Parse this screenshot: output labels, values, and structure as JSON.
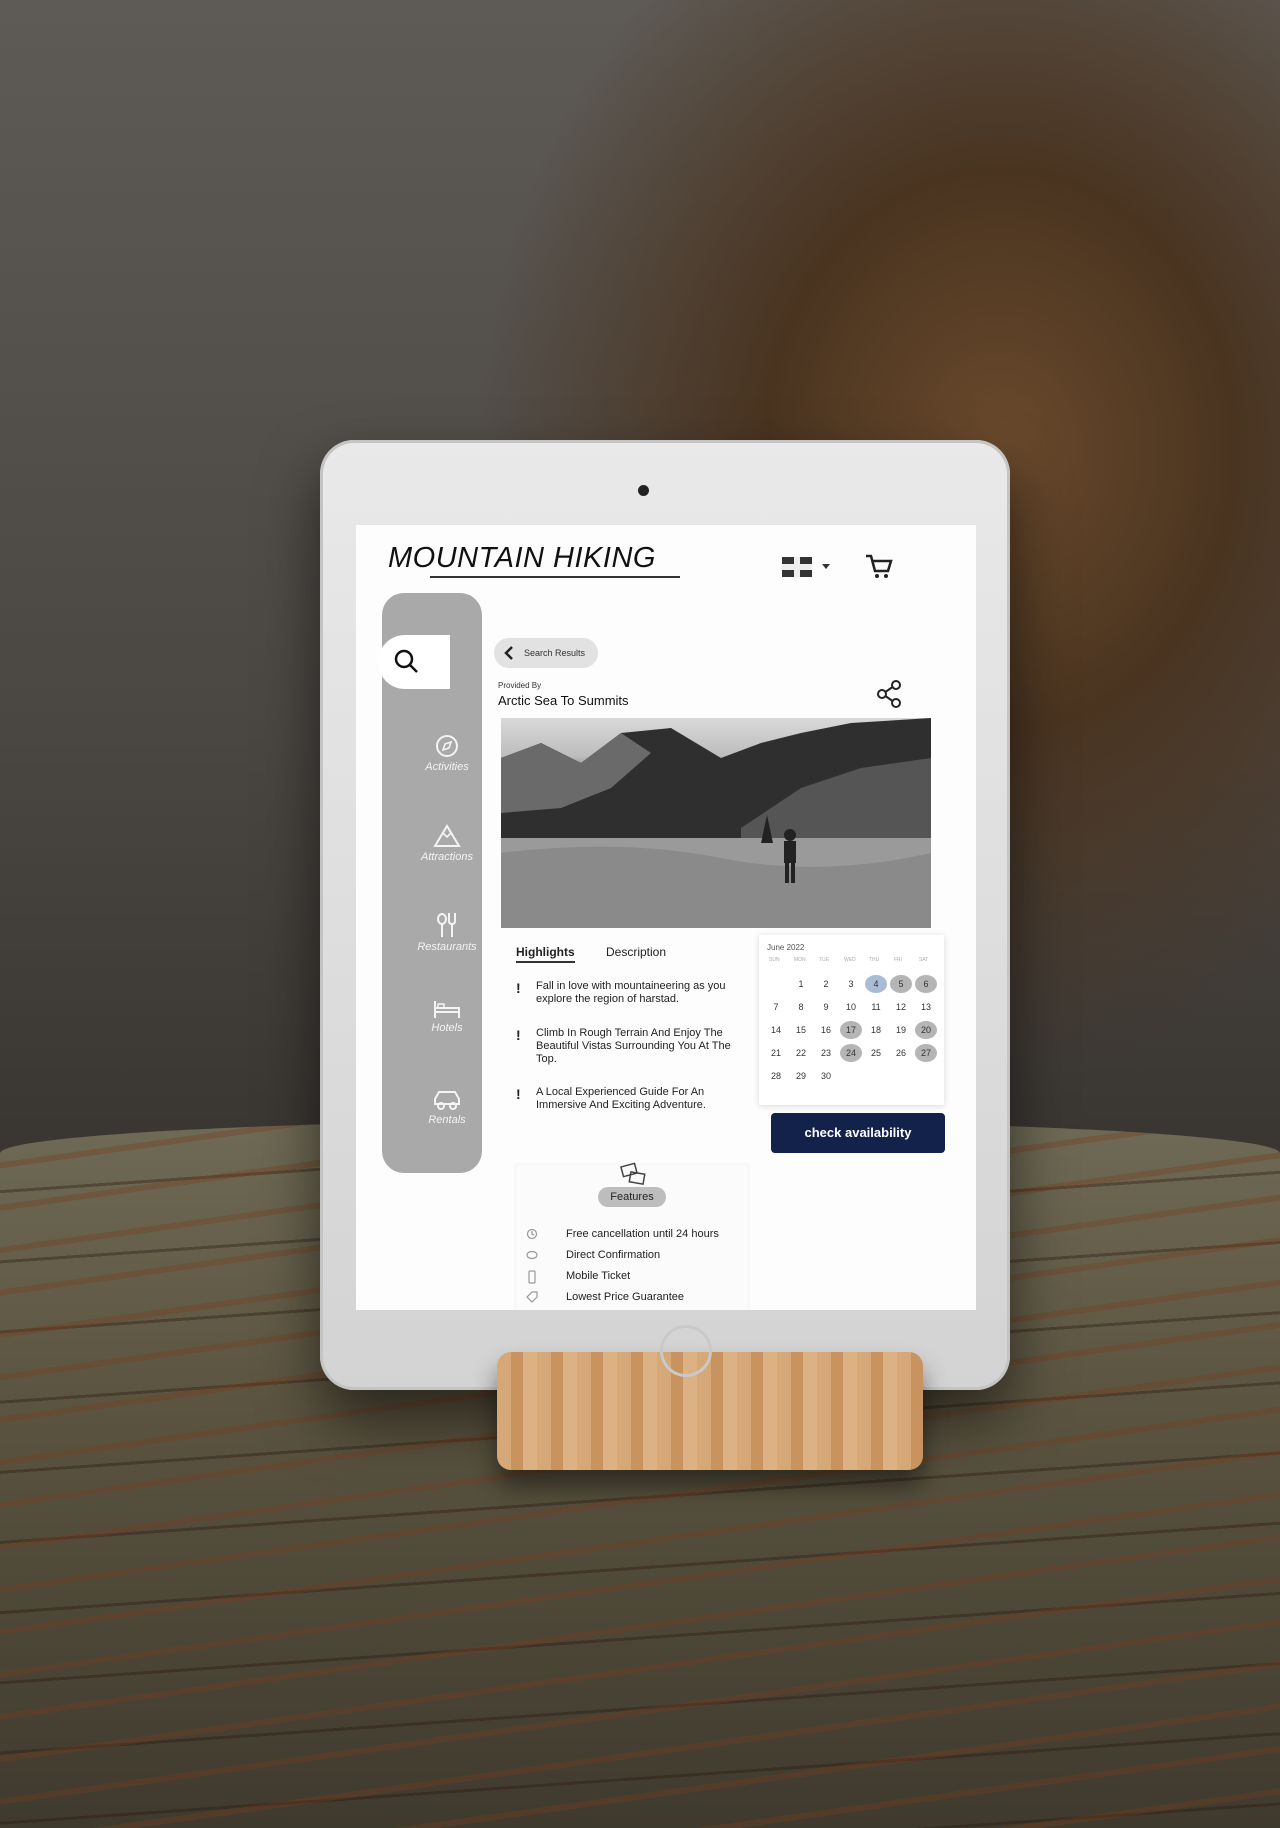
{
  "header": {
    "title": "MOUNTAIN HIKING",
    "language_icon": "uk-flag-icon",
    "cart_icon": "cart-icon"
  },
  "sidebar": {
    "search_icon": "search-icon",
    "items": [
      {
        "label": "Activities",
        "icon": "compass-icon"
      },
      {
        "label": "Attractions",
        "icon": "mountain-icon"
      },
      {
        "label": "Restaurants",
        "icon": "cutlery-icon"
      },
      {
        "label": "Hotels",
        "icon": "bed-icon"
      },
      {
        "label": "Rentals",
        "icon": "car-icon"
      }
    ]
  },
  "detail": {
    "back_label": "Search Results",
    "provided_by_label": "Provided By",
    "provider_name": "Arctic Sea To Summits",
    "share_icon": "share-icon",
    "tabs": [
      {
        "label": "Highlights",
        "active": true
      },
      {
        "label": "Description",
        "active": false
      }
    ],
    "highlights": [
      "Fall in love with mountaineering as you explore the region of harstad.",
      "Climb In Rough Terrain And Enjoy The Beautiful Vistas Surrounding You At The Top.",
      "A Local Experienced Guide For An Immersive And Exciting Adventure."
    ]
  },
  "calendar": {
    "month_label": "June 2022",
    "weekdays": [
      "SUN",
      "MON",
      "TUE",
      "WED",
      "THU",
      "FRI",
      "SAT"
    ],
    "weeks": [
      [
        "",
        "1",
        "2",
        "3",
        "4",
        "5",
        "6"
      ],
      [
        "7",
        "8",
        "9",
        "10",
        "11",
        "12",
        "13"
      ],
      [
        "14",
        "15",
        "16",
        "17",
        "18",
        "19",
        "20"
      ],
      [
        "21",
        "22",
        "23",
        "24",
        "25",
        "26",
        "27"
      ],
      [
        "28",
        "29",
        "30",
        "",
        "",
        "",
        ""
      ]
    ],
    "highlighted_days": [
      "4"
    ],
    "selected_days": [
      "5",
      "6",
      "17",
      "20",
      "24",
      "27"
    ],
    "button_label": "check availability",
    "button_color": "#13224a"
  },
  "features": {
    "title": "Features",
    "items": [
      {
        "label": "Free cancellation until 24 hours",
        "icon": "history-icon"
      },
      {
        "label": "Direct Confirmation",
        "icon": "thumbs-up-icon"
      },
      {
        "label": "Mobile Ticket",
        "icon": "mobile-icon"
      },
      {
        "label": "Lowest Price Guarantee",
        "icon": "tag-icon"
      }
    ]
  }
}
